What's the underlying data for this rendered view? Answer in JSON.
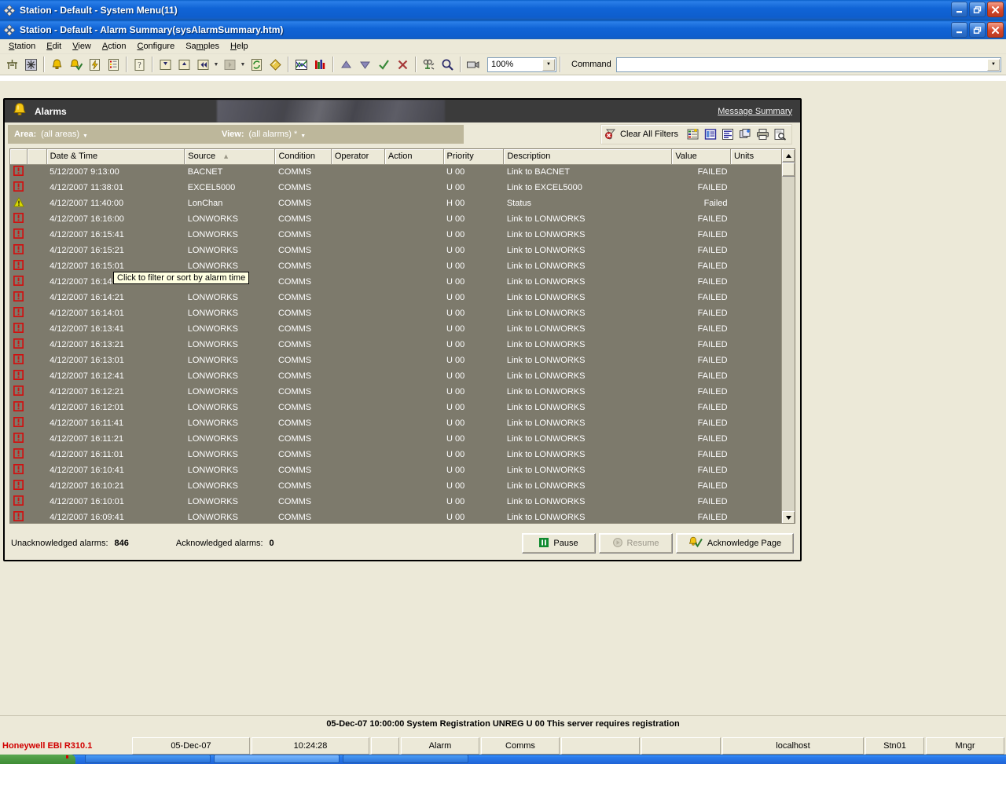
{
  "window": {
    "title_1": "Station - Default - System Menu(11)",
    "title_2": "Station - Default - Alarm Summary(sysAlarmSummary.htm)",
    "minimize_label": "Minimize",
    "restore_label": "Restore",
    "close_label": "Close"
  },
  "menubar": {
    "items": [
      {
        "label": "Station"
      },
      {
        "label": "Edit"
      },
      {
        "label": "View"
      },
      {
        "label": "Action"
      },
      {
        "label": "Configure"
      },
      {
        "label": "Samples"
      },
      {
        "label": "Help"
      }
    ]
  },
  "toolbar": {
    "zoom_value": "100%",
    "command_label": "Command",
    "command_value": "",
    "icons": [
      "home-icon",
      "station-snowflake-icon",
      "alarm-bell-icon",
      "acknowledge-bell-icon",
      "alert-lightning-icon",
      "alarm-list-icon",
      "help-page-icon",
      "page-down-icon",
      "page-up-icon",
      "back-icon",
      "forward-icon",
      "refresh-page-icon",
      "diamond-tag-icon",
      "trend-chart-icon",
      "bar-graph-icon",
      "up-arrow-icon",
      "down-arrow-icon",
      "check-icon",
      "cancel-x-icon",
      "point-detail-icon",
      "search-icon",
      "camera-icon"
    ]
  },
  "alarm_page": {
    "banner_title": "Alarms",
    "banner_link": "Message Summary",
    "area_label": "Area:",
    "area_value": "(all areas)",
    "view_label": "View:",
    "view_value": "(all alarms) *",
    "clear_filters_label": "Clear All Filters",
    "filter_icons": [
      "alarm-filter-icon",
      "point-detail-icon",
      "alarm-detail-icon",
      "associated-display-icon",
      "print-icon",
      "print-preview-icon"
    ],
    "tooltip": "Click to filter or sort by alarm time",
    "columns": [
      {
        "key": "priority_icon",
        "label": ""
      },
      {
        "key": "ack_icon",
        "label": ""
      },
      {
        "key": "datetime",
        "label": "Date & Time"
      },
      {
        "key": "source",
        "label": "Source",
        "sorted": "asc"
      },
      {
        "key": "condition",
        "label": "Condition"
      },
      {
        "key": "operator",
        "label": "Operator"
      },
      {
        "key": "action",
        "label": "Action"
      },
      {
        "key": "priority",
        "label": "Priority"
      },
      {
        "key": "description",
        "label": "Description"
      },
      {
        "key": "value",
        "label": "Value"
      },
      {
        "key": "units",
        "label": "Units"
      }
    ],
    "rows": [
      {
        "icon": "urgent",
        "datetime": "5/12/2007 9:13:00",
        "source": "BACNET",
        "condition": "COMMS",
        "operator": "",
        "action": "",
        "priority": "U 00",
        "description": "Link to BACNET",
        "value": "FAILED",
        "units": ""
      },
      {
        "icon": "urgent",
        "datetime": "4/12/2007 11:38:01",
        "source": "EXCEL5000",
        "condition": "COMMS",
        "operator": "",
        "action": "",
        "priority": "U 00",
        "description": "Link to EXCEL5000",
        "value": "FAILED",
        "units": ""
      },
      {
        "icon": "warning",
        "datetime": "4/12/2007 11:40:00",
        "source": "LonChan",
        "condition": "COMMS",
        "operator": "",
        "action": "",
        "priority": "H 00",
        "description": "Status",
        "value": "Failed",
        "units": ""
      },
      {
        "icon": "urgent",
        "datetime": "4/12/2007 16:16:00",
        "source": "LONWORKS",
        "condition": "COMMS",
        "operator": "",
        "action": "",
        "priority": "U 00",
        "description": "Link to LONWORKS",
        "value": "FAILED",
        "units": ""
      },
      {
        "icon": "urgent",
        "datetime": "4/12/2007 16:15:41",
        "source": "LONWORKS",
        "condition": "COMMS",
        "operator": "",
        "action": "",
        "priority": "U 00",
        "description": "Link to LONWORKS",
        "value": "FAILED",
        "units": ""
      },
      {
        "icon": "urgent",
        "datetime": "4/12/2007 16:15:21",
        "source": "LONWORKS",
        "condition": "COMMS",
        "operator": "",
        "action": "",
        "priority": "U 00",
        "description": "Link to LONWORKS",
        "value": "FAILED",
        "units": ""
      },
      {
        "icon": "urgent",
        "datetime": "4/12/2007 16:15:01",
        "source": "LONWORKS",
        "condition": "COMMS",
        "operator": "",
        "action": "",
        "priority": "U 00",
        "description": "Link to LONWORKS",
        "value": "FAILED",
        "units": ""
      },
      {
        "icon": "urgent",
        "datetime": "4/12/2007 16:14:41",
        "source": "LONWORKS",
        "condition": "COMMS",
        "operator": "",
        "action": "",
        "priority": "U 00",
        "description": "Link to LONWORKS",
        "value": "FAILED",
        "units": ""
      },
      {
        "icon": "urgent",
        "datetime": "4/12/2007 16:14:21",
        "source": "LONWORKS",
        "condition": "COMMS",
        "operator": "",
        "action": "",
        "priority": "U 00",
        "description": "Link to LONWORKS",
        "value": "FAILED",
        "units": ""
      },
      {
        "icon": "urgent",
        "datetime": "4/12/2007 16:14:01",
        "source": "LONWORKS",
        "condition": "COMMS",
        "operator": "",
        "action": "",
        "priority": "U 00",
        "description": "Link to LONWORKS",
        "value": "FAILED",
        "units": ""
      },
      {
        "icon": "urgent",
        "datetime": "4/12/2007 16:13:41",
        "source": "LONWORKS",
        "condition": "COMMS",
        "operator": "",
        "action": "",
        "priority": "U 00",
        "description": "Link to LONWORKS",
        "value": "FAILED",
        "units": ""
      },
      {
        "icon": "urgent",
        "datetime": "4/12/2007 16:13:21",
        "source": "LONWORKS",
        "condition": "COMMS",
        "operator": "",
        "action": "",
        "priority": "U 00",
        "description": "Link to LONWORKS",
        "value": "FAILED",
        "units": ""
      },
      {
        "icon": "urgent",
        "datetime": "4/12/2007 16:13:01",
        "source": "LONWORKS",
        "condition": "COMMS",
        "operator": "",
        "action": "",
        "priority": "U 00",
        "description": "Link to LONWORKS",
        "value": "FAILED",
        "units": ""
      },
      {
        "icon": "urgent",
        "datetime": "4/12/2007 16:12:41",
        "source": "LONWORKS",
        "condition": "COMMS",
        "operator": "",
        "action": "",
        "priority": "U 00",
        "description": "Link to LONWORKS",
        "value": "FAILED",
        "units": ""
      },
      {
        "icon": "urgent",
        "datetime": "4/12/2007 16:12:21",
        "source": "LONWORKS",
        "condition": "COMMS",
        "operator": "",
        "action": "",
        "priority": "U 00",
        "description": "Link to LONWORKS",
        "value": "FAILED",
        "units": ""
      },
      {
        "icon": "urgent",
        "datetime": "4/12/2007 16:12:01",
        "source": "LONWORKS",
        "condition": "COMMS",
        "operator": "",
        "action": "",
        "priority": "U 00",
        "description": "Link to LONWORKS",
        "value": "FAILED",
        "units": ""
      },
      {
        "icon": "urgent",
        "datetime": "4/12/2007 16:11:41",
        "source": "LONWORKS",
        "condition": "COMMS",
        "operator": "",
        "action": "",
        "priority": "U 00",
        "description": "Link to LONWORKS",
        "value": "FAILED",
        "units": ""
      },
      {
        "icon": "urgent",
        "datetime": "4/12/2007 16:11:21",
        "source": "LONWORKS",
        "condition": "COMMS",
        "operator": "",
        "action": "",
        "priority": "U 00",
        "description": "Link to LONWORKS",
        "value": "FAILED",
        "units": ""
      },
      {
        "icon": "urgent",
        "datetime": "4/12/2007 16:11:01",
        "source": "LONWORKS",
        "condition": "COMMS",
        "operator": "",
        "action": "",
        "priority": "U 00",
        "description": "Link to LONWORKS",
        "value": "FAILED",
        "units": ""
      },
      {
        "icon": "urgent",
        "datetime": "4/12/2007 16:10:41",
        "source": "LONWORKS",
        "condition": "COMMS",
        "operator": "",
        "action": "",
        "priority": "U 00",
        "description": "Link to LONWORKS",
        "value": "FAILED",
        "units": ""
      },
      {
        "icon": "urgent",
        "datetime": "4/12/2007 16:10:21",
        "source": "LONWORKS",
        "condition": "COMMS",
        "operator": "",
        "action": "",
        "priority": "U 00",
        "description": "Link to LONWORKS",
        "value": "FAILED",
        "units": ""
      },
      {
        "icon": "urgent",
        "datetime": "4/12/2007 16:10:01",
        "source": "LONWORKS",
        "condition": "COMMS",
        "operator": "",
        "action": "",
        "priority": "U 00",
        "description": "Link to LONWORKS",
        "value": "FAILED",
        "units": ""
      },
      {
        "icon": "urgent",
        "datetime": "4/12/2007 16:09:41",
        "source": "LONWORKS",
        "condition": "COMMS",
        "operator": "",
        "action": "",
        "priority": "U 00",
        "description": "Link to LONWORKS",
        "value": "FAILED",
        "units": ""
      }
    ],
    "footer": {
      "unack_label": "Unacknowledged alarms:",
      "unack_value": "846",
      "ack_label": "Acknowledged alarms:",
      "ack_value": "0",
      "pause_label": "Pause",
      "resume_label": "Resume",
      "acknowledge_page_label": "Acknowledge Page"
    }
  },
  "system_message": "05-Dec-07  10:00:00  System  Registration   UNREG   U 00 This server requires registration",
  "statusbar": {
    "brand": "Honeywell EBI R310.1",
    "date": "05-Dec-07",
    "time": "10:24:28",
    "alarm": "Alarm",
    "comms": "Comms",
    "blank": "",
    "server": "localhost",
    "station": "Stn01",
    "user": "Mngr"
  },
  "colors": {
    "accent_blue": "#1064d6",
    "urgent_red": "#cc0000",
    "warning_yellow": "#d8d800",
    "grid_bg": "#7d7a6c",
    "chrome": "#ece9d8",
    "brand_red": "#d10000"
  }
}
